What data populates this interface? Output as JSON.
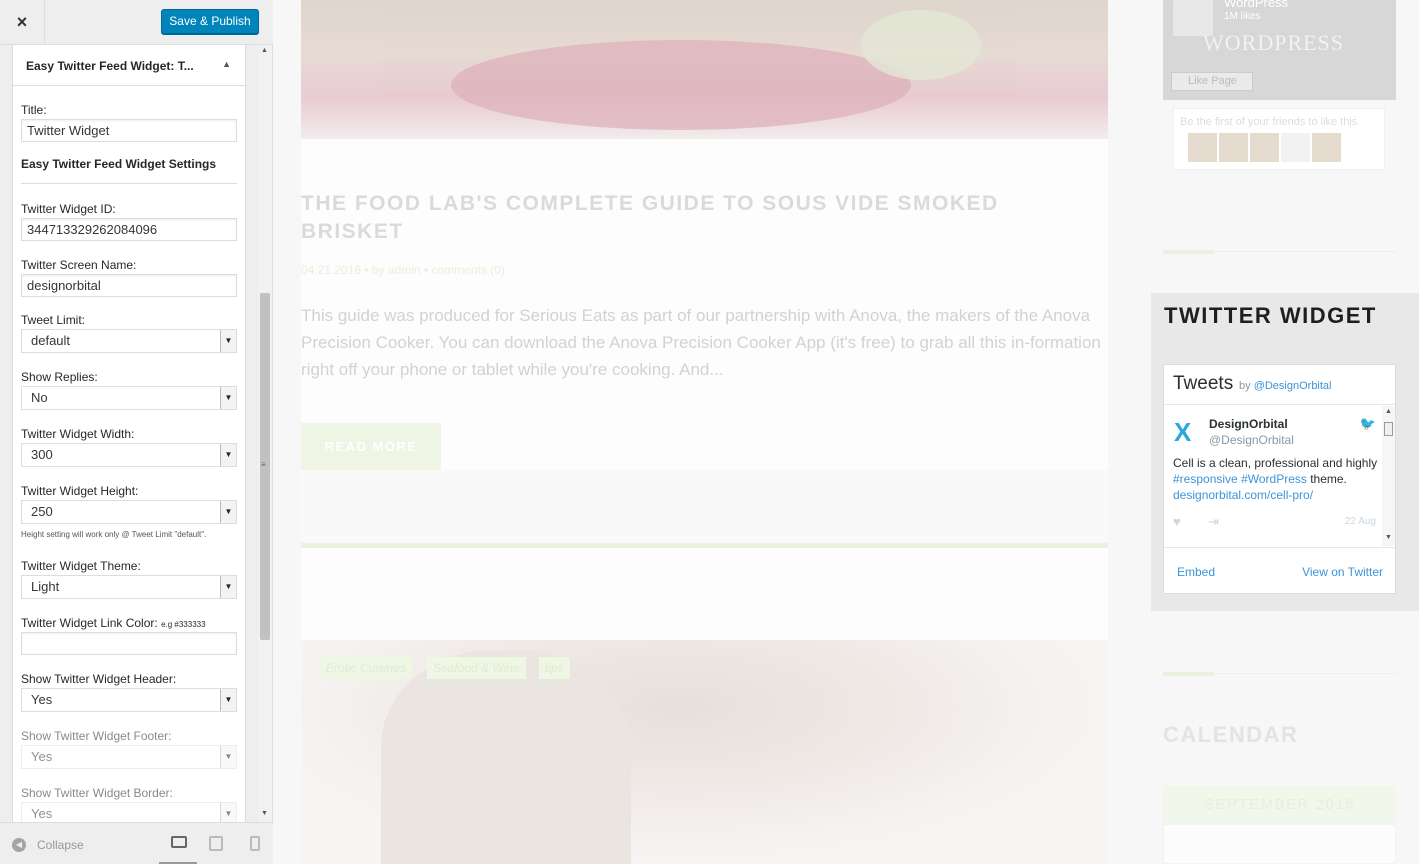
{
  "customizer": {
    "close_icon": "×",
    "save_label": "Save & Publish",
    "widget_title": "Easy Twitter Feed Widget: T...",
    "widget_toggle_icon": "▲",
    "form": {
      "title_label": "Title:",
      "title_value": "Twitter Widget",
      "settings_heading": "Easy Twitter Feed Widget Settings",
      "widget_id_label": "Twitter Widget ID:",
      "widget_id_value": "344713329262084096",
      "screen_name_label": "Twitter Screen Name:",
      "screen_name_value": "designorbital",
      "tweet_limit_label": "Tweet Limit:",
      "tweet_limit_value": "default",
      "show_replies_label": "Show Replies:",
      "show_replies_value": "No",
      "width_label": "Twitter Widget Width:",
      "width_value": "300",
      "height_label": "Twitter Widget Height:",
      "height_value": "250",
      "height_note": "Height setting will work only @ Tweet Limit \"default\".",
      "theme_label": "Twitter Widget Theme:",
      "theme_value": "Light",
      "link_color_label": "Twitter Widget Link Color:",
      "link_color_hint": "e.g #333333",
      "link_color_value": "",
      "show_header_label": "Show Twitter Widget Header:",
      "show_header_value": "Yes",
      "show_footer_label": "Show Twitter Widget Footer:",
      "show_footer_value": "Yes",
      "show_border_label": "Show Twitter Widget Border:",
      "show_border_value": "Yes"
    },
    "footer": {
      "collapse_label": "Collapse"
    },
    "colors": {
      "primary_button": "#0085ba",
      "panel_bg": "#eeeeee"
    }
  },
  "preview": {
    "post": {
      "title": "THE FOOD LAB'S COMPLETE GUIDE TO SOUS VIDE SMOKED BRISKET",
      "meta": "04.21.2016  •  by admin  •  comments (0)",
      "excerpt": "This guide was produced for Serious Eats as part of our partnership with Anova, the makers of the Anova Precision Cooker. You can download the Anova Precision Cooker App (it's free) to grab all this in-formation right off your phone or tablet while you're cooking. And...",
      "read_more": "READ MORE"
    },
    "tags": [
      "Erotic Cuisines",
      "Seafood & Wine",
      "tips"
    ],
    "facebook": {
      "page_name": "WordPress",
      "likes": "1M likes",
      "wordmark": "WORDPRESS",
      "like_button": "Like Page",
      "friends_text": "Be the first of your friends to like this"
    },
    "twitter_widget": {
      "title": "TWITTER WIDGET",
      "tweets_label": "Tweets",
      "by_label": "by",
      "handle": "@DesignOrbital",
      "tweet": {
        "user_name": "DesignOrbital",
        "screen_name": "@DesignOrbital",
        "text_start": "Cell is a clean, professional and highly ",
        "hashtag1": "#responsive",
        "hashtag2": "#WordPress",
        "text_mid": " theme.",
        "url": "designorbital.com/cell-pro/",
        "date": "22 Aug"
      },
      "embed_link": "Embed",
      "view_link": "View on Twitter"
    },
    "calendar": {
      "title": "CALENDAR",
      "month": "SEPTEMBER 2016"
    },
    "colors": {
      "accent_green": "#e8f2dc",
      "twitter_blue": "#3b94d9"
    }
  }
}
